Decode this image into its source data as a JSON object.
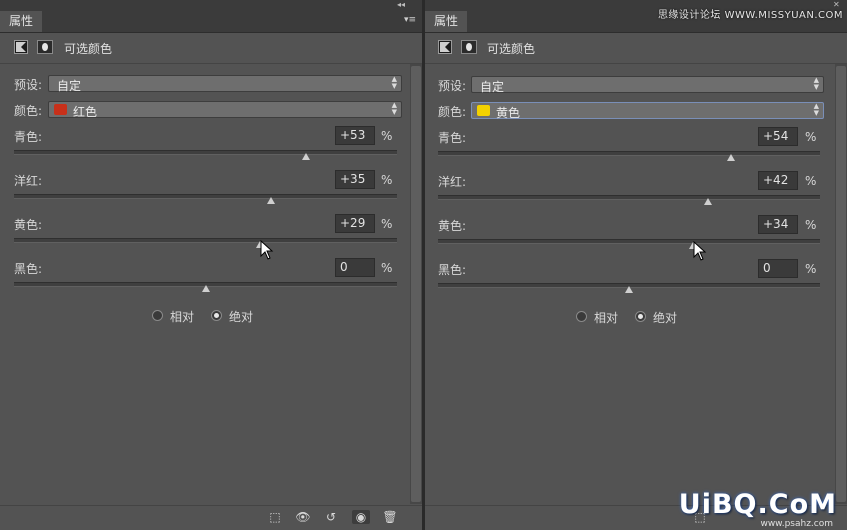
{
  "watermark": {
    "top_text": "思缘设计论坛 WWW.MISSYUAN.COM",
    "logo": "UiBQ.CoM",
    "sub": "www.psahz.com"
  },
  "panels": [
    {
      "tab": "属性",
      "title": "可选颜色",
      "preset_label": "预设:",
      "preset_value": "自定",
      "color_label": "颜色:",
      "color_value": "红色",
      "color_swatch": "#c8301a",
      "sliders": [
        {
          "label": "青色:",
          "value": "+53",
          "unit": "%",
          "position": 0.765
        },
        {
          "label": "洋红:",
          "value": "+35",
          "unit": "%",
          "position": 0.675
        },
        {
          "label": "黄色:",
          "value": "+29",
          "unit": "%",
          "position": 0.645
        },
        {
          "label": "黑色:",
          "value": "0",
          "unit": "%",
          "position": 0.5
        }
      ],
      "radios": [
        {
          "label": "相对",
          "checked": false
        },
        {
          "label": "绝对",
          "checked": true
        }
      ]
    },
    {
      "tab": "属性",
      "title": "可选颜色",
      "preset_label": "预设:",
      "preset_value": "自定",
      "color_label": "颜色:",
      "color_value": "黄色",
      "color_swatch": "#f3d100",
      "sliders": [
        {
          "label": "青色:",
          "value": "+54",
          "unit": "%",
          "position": 0.77
        },
        {
          "label": "洋红:",
          "value": "+42",
          "unit": "%",
          "position": 0.71
        },
        {
          "label": "黄色:",
          "value": "+34",
          "unit": "%",
          "position": 0.67
        },
        {
          "label": "黑色:",
          "value": "0",
          "unit": "%",
          "position": 0.5
        }
      ],
      "radios": [
        {
          "label": "相对",
          "checked": false
        },
        {
          "label": "绝对",
          "checked": true
        }
      ]
    }
  ],
  "bottom_icons": [
    "clip-to-layer-icon",
    "view-previous-state-icon",
    "reset-icon",
    "visibility-eye-icon",
    "trash-icon"
  ]
}
